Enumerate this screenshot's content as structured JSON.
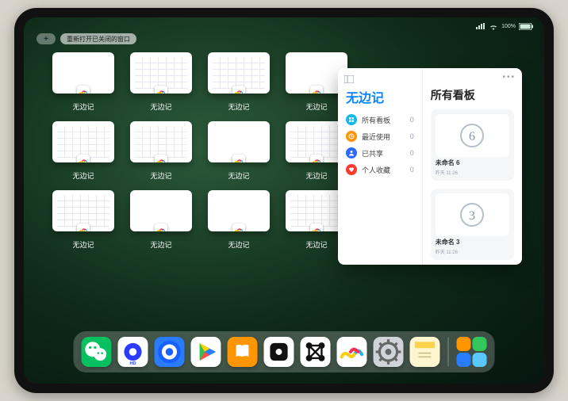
{
  "status": {
    "battery": "100%"
  },
  "topbar": {
    "plus": "+",
    "reopen": "重新打开已关闭的窗口"
  },
  "app_name": "无边记",
  "windows": [
    {
      "label": "无边记",
      "style": "blank"
    },
    {
      "label": "无边记",
      "style": "cal"
    },
    {
      "label": "无边记",
      "style": "cal"
    },
    {
      "label": "无边记",
      "style": "blank"
    },
    {
      "label": "无边记",
      "style": "cal"
    },
    {
      "label": "无边记",
      "style": "cal"
    },
    {
      "label": "无边记",
      "style": "blank"
    },
    {
      "label": "无边记",
      "style": "cal"
    },
    {
      "label": "无边记",
      "style": "cal"
    },
    {
      "label": "无边记",
      "style": "blank"
    },
    {
      "label": "无边记",
      "style": "blank"
    },
    {
      "label": "无边记",
      "style": "cal"
    }
  ],
  "panel": {
    "left_title": "无边记",
    "nav": [
      {
        "label": "所有看板",
        "count": "0",
        "color": "#17b8ea",
        "icon": "grid"
      },
      {
        "label": "最近使用",
        "count": "0",
        "color": "#ff9500",
        "icon": "clock"
      },
      {
        "label": "已共享",
        "count": "0",
        "color": "#2c68ff",
        "icon": "person"
      },
      {
        "label": "个人收藏",
        "count": "0",
        "color": "#ff3b30",
        "icon": "heart"
      }
    ],
    "right_title": "所有看板",
    "boards": [
      {
        "name": "未命名 6",
        "date": "昨天 11:26",
        "glyph": "6"
      },
      {
        "name": "未命名 3",
        "date": "昨天 11:26",
        "glyph": "3"
      }
    ]
  },
  "dock": [
    {
      "name": "wechat",
      "bg": "#07c160"
    },
    {
      "name": "quark",
      "bg": "#ffffff"
    },
    {
      "name": "browser",
      "bg": "#2a7cff"
    },
    {
      "name": "play",
      "bg": "#ffffff"
    },
    {
      "name": "books",
      "bg": "#ff9500"
    },
    {
      "name": "dice",
      "bg": "#ffffff"
    },
    {
      "name": "graph",
      "bg": "#ffffff"
    },
    {
      "name": "freeform",
      "bg": "#ffffff"
    },
    {
      "name": "settings",
      "bg": "#d0d4d9"
    },
    {
      "name": "notes",
      "bg": "#fff6d0"
    }
  ]
}
